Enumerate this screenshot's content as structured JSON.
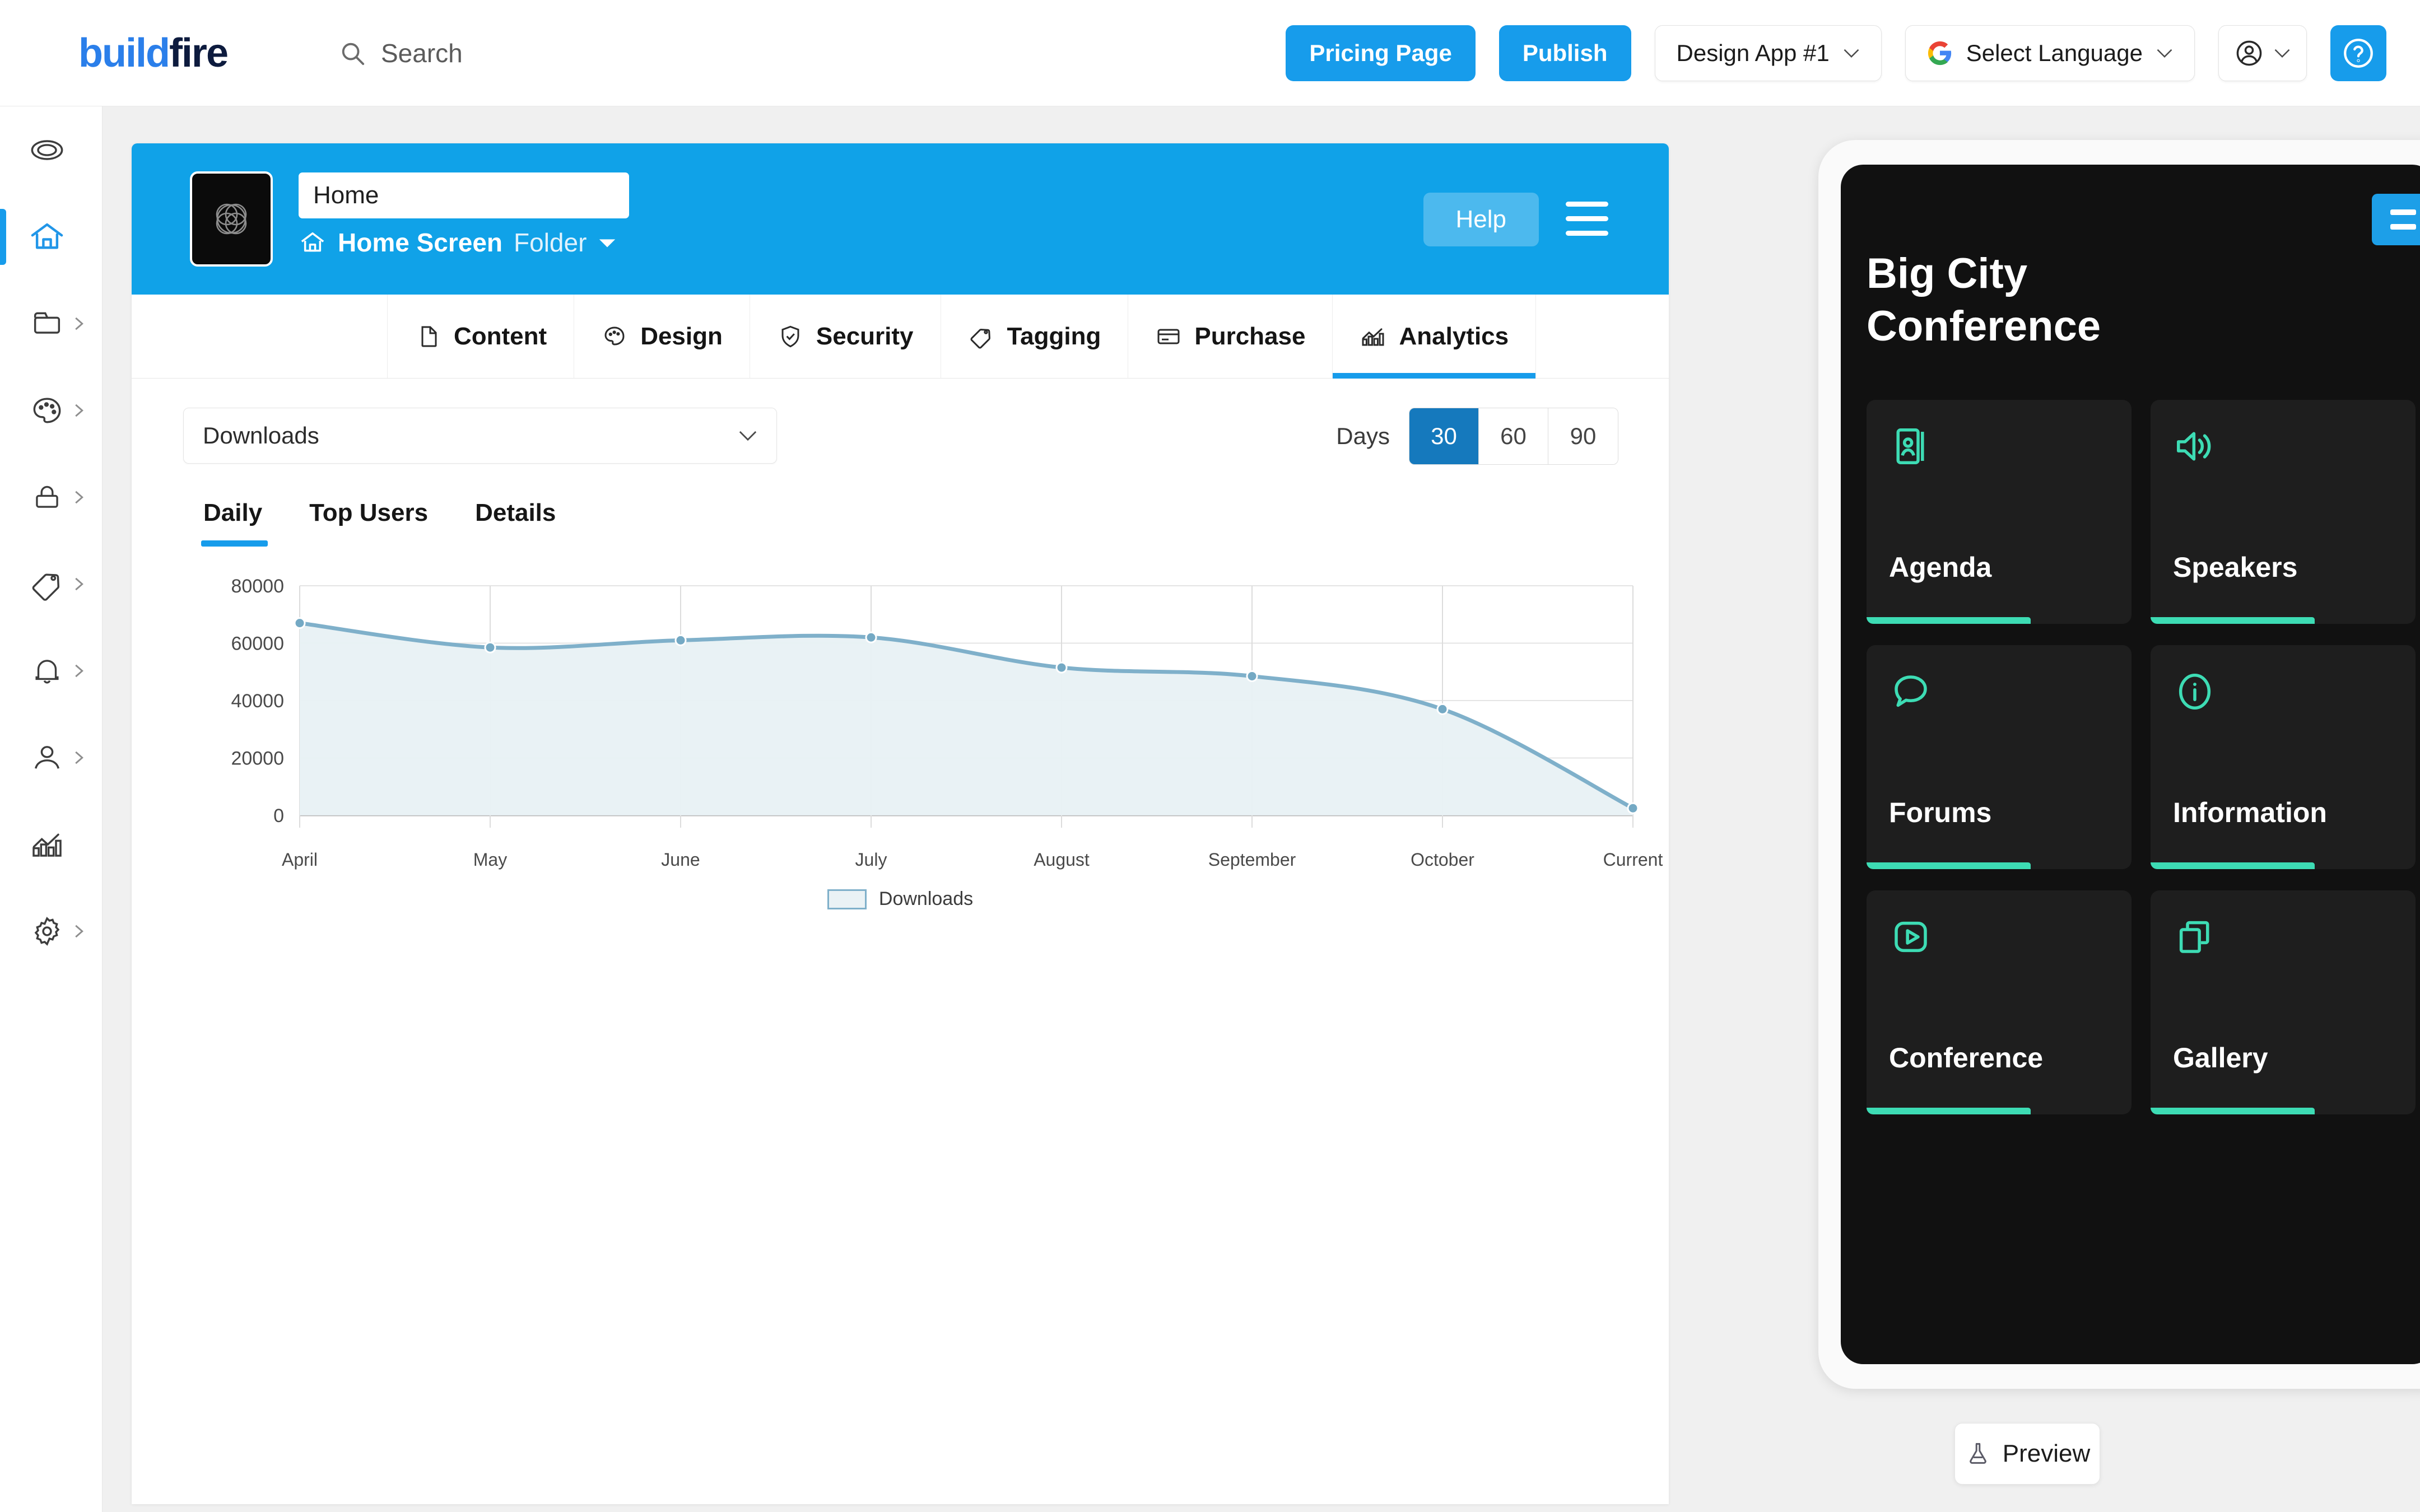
{
  "brand": {
    "name_prefix": "build",
    "name_suffix": "fire",
    "color_blue": "#2b7fea",
    "color_navy": "#0d1b3e"
  },
  "header": {
    "search_placeholder": "Search",
    "pricing_label": "Pricing Page",
    "publish_label": "Publish",
    "app_selector_label": "Design App #1",
    "language_label": "Select Language",
    "accent": "#179ceb"
  },
  "sidebar": {
    "items": [
      {
        "name": "dashboard",
        "icon": "rings-icon",
        "active": false,
        "has_arrow": false
      },
      {
        "name": "home",
        "icon": "home-icon",
        "active": true,
        "has_arrow": false
      },
      {
        "name": "content",
        "icon": "briefcase-icon",
        "active": false,
        "has_arrow": true
      },
      {
        "name": "design",
        "icon": "palette-icon",
        "active": false,
        "has_arrow": true
      },
      {
        "name": "security",
        "icon": "lock-icon",
        "active": false,
        "has_arrow": true
      },
      {
        "name": "tagging",
        "icon": "tag-icon",
        "active": false,
        "has_arrow": true
      },
      {
        "name": "notifications",
        "icon": "bell-icon",
        "active": false,
        "has_arrow": true
      },
      {
        "name": "users",
        "icon": "person-icon",
        "active": false,
        "has_arrow": true
      },
      {
        "name": "analytics",
        "icon": "bar-chart-icon",
        "active": false,
        "has_arrow": false
      },
      {
        "name": "settings",
        "icon": "gear-icon",
        "active": false,
        "has_arrow": true
      }
    ]
  },
  "editor": {
    "app_title_value": "Home",
    "breadcrumb_screen": "Home Screen",
    "breadcrumb_folder": "Folder",
    "help_label": "Help",
    "tabs": [
      {
        "label": "Content",
        "icon": "document-icon",
        "active": false
      },
      {
        "label": "Design",
        "icon": "palette-icon",
        "active": false
      },
      {
        "label": "Security",
        "icon": "shield-icon",
        "active": false
      },
      {
        "label": "Tagging",
        "icon": "tag-icon",
        "active": false
      },
      {
        "label": "Purchase",
        "icon": "card-icon",
        "active": false
      },
      {
        "label": "Analytics",
        "icon": "bar-chart-icon",
        "active": true
      }
    ]
  },
  "analytics": {
    "metric_selected": "Downloads",
    "days_label": "Days",
    "day_options": [
      {
        "label": "30",
        "selected": true
      },
      {
        "label": "60",
        "selected": false
      },
      {
        "label": "90",
        "selected": false
      }
    ],
    "subtabs": [
      {
        "label": "Daily",
        "active": true
      },
      {
        "label": "Top Users",
        "active": false
      },
      {
        "label": "Details",
        "active": false
      }
    ]
  },
  "chart_data": {
    "type": "area",
    "title": "",
    "xlabel": "",
    "ylabel": "",
    "categories": [
      "April",
      "May",
      "June",
      "July",
      "August",
      "September",
      "October",
      "Current"
    ],
    "series": [
      {
        "name": "Downloads",
        "values": [
          67000,
          58500,
          61000,
          62000,
          51500,
          48500,
          37000,
          2500
        ]
      }
    ],
    "ytick_labels": [
      "0",
      "20000",
      "40000",
      "60000",
      "80000"
    ],
    "ylim": [
      0,
      80000
    ],
    "grid": true,
    "legend": [
      "Downloads"
    ],
    "legend_position": "bottom",
    "line_color": "#7fb0ca",
    "fill_color": "#e8f1f4"
  },
  "preview": {
    "app_title": "Big City Conference",
    "menu_icon": "hamburger-icon",
    "accent": "#3ddcb4",
    "tiles": [
      {
        "label": "Agenda",
        "icon": "contact-card-icon"
      },
      {
        "label": "Speakers",
        "icon": "speaker-icon"
      },
      {
        "label": "Forums",
        "icon": "chat-bubble-icon"
      },
      {
        "label": "Information",
        "icon": "info-circle-icon"
      },
      {
        "label": "Conference",
        "icon": "play-square-icon"
      },
      {
        "label": "Gallery",
        "icon": "copy-icon"
      }
    ],
    "preview_button_label": "Preview"
  }
}
